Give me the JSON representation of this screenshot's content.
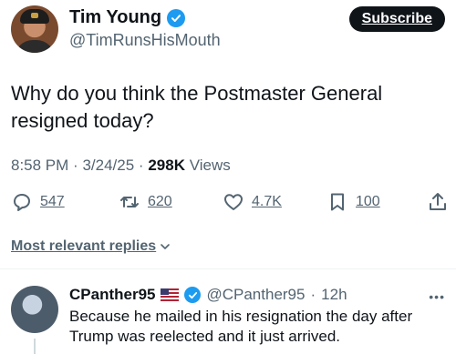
{
  "author": {
    "name": "Tim Young",
    "handle": "@TimRunsHisMouth"
  },
  "subscribe_label": "Subscribe",
  "tweet": {
    "text": "Why do you think the Postmaster General resigned today?"
  },
  "meta": {
    "time": "8:58 PM",
    "separator": "·",
    "date": "3/24/25",
    "views_count": "298K",
    "views_label": "Views"
  },
  "actions": {
    "replies": "547",
    "reposts": "620",
    "likes": "4.7K",
    "bookmarks": "100"
  },
  "replies_filter": {
    "label": "Most relevant replies"
  },
  "reply": {
    "name": "CPanther95",
    "handle": "@CPanther95",
    "separator": "·",
    "time": "12h",
    "text": "Because he mailed in his resignation the day after Trump was reelected and it just arrived."
  },
  "colors": {
    "verified": "#1d9bf0",
    "muted_text": "#536471",
    "primary_text": "#0f1419"
  },
  "icons": {
    "reply": "speech-bubble-icon",
    "repost": "repost-arrows-icon",
    "like": "heart-icon",
    "bookmark": "bookmark-icon",
    "share": "share-upload-icon",
    "verified": "verified-check-icon",
    "more": "more-dots-icon",
    "dropdown": "chevron-down-icon"
  }
}
